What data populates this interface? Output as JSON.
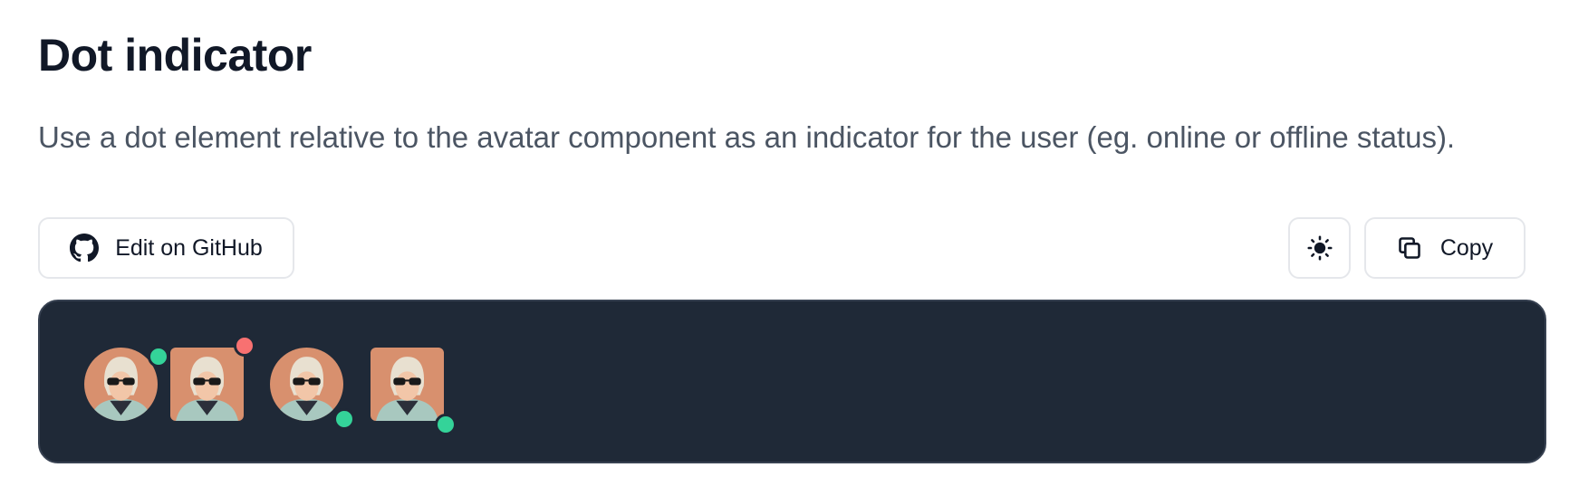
{
  "header": {
    "title": "Dot indicator",
    "description": "Use a dot element relative to the avatar component as an indicator for the user (eg. online or offline status)."
  },
  "toolbar": {
    "github_label": "Edit on GitHub",
    "github_icon": "github-icon",
    "theme_icon": "sun-icon",
    "copy_label": "Copy",
    "copy_icon": "copy-icon"
  },
  "preview": {
    "background": "#1f2937",
    "avatars": [
      {
        "shape": "rounded",
        "status": "online",
        "dot_position": "top-right"
      },
      {
        "shape": "square",
        "status": "offline",
        "dot_position": "top-right"
      },
      {
        "shape": "rounded",
        "status": "online",
        "dot_position": "bottom-right"
      },
      {
        "shape": "square",
        "status": "online",
        "dot_position": "bottom-right"
      }
    ]
  },
  "colors": {
    "online": "#34d399",
    "offline": "#f87171"
  }
}
